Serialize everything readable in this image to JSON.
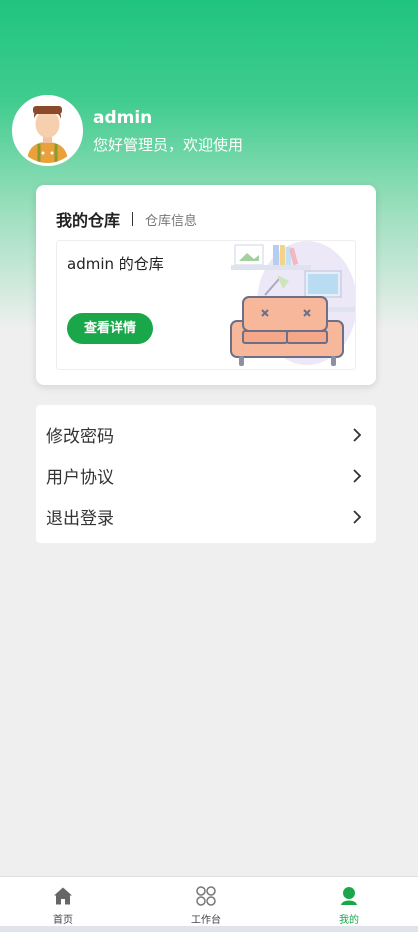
{
  "profile": {
    "username": "admin",
    "greeting": "您好管理员，欢迎使用"
  },
  "warehouse_card": {
    "title": "我的仓库",
    "subtitle": "仓库信息",
    "warehouse_name": "admin 的仓库",
    "detail_button": "查看详情"
  },
  "menu": {
    "items": [
      {
        "label": "修改密码",
        "icon": "chevron-right-icon"
      },
      {
        "label": "用户协议",
        "icon": "chevron-right-icon"
      },
      {
        "label": "退出登录",
        "icon": "chevron-right-icon"
      }
    ]
  },
  "tabbar": {
    "items": [
      {
        "label": "首页",
        "icon": "home-icon"
      },
      {
        "label": "工作台",
        "icon": "workbench-icon"
      },
      {
        "label": "我的",
        "icon": "user-icon",
        "active": true
      }
    ]
  },
  "colors": {
    "brand_green": "#1aa74a",
    "header_green": "#20c47f"
  }
}
